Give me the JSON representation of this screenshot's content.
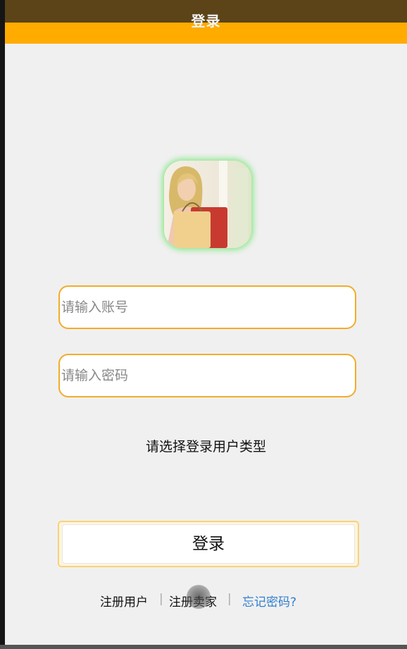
{
  "header": {
    "title": "登录"
  },
  "form": {
    "account_placeholder": "请输入账号",
    "password_placeholder": "请输入密码",
    "user_type_prompt": "请选择登录用户类型",
    "login_label": "登录"
  },
  "footer": {
    "register_user": "注册用户",
    "separator": "|",
    "register_seller": "注册卖家",
    "forgot_password": "忘记密码?"
  },
  "colors": {
    "header_dark": "#5c4418",
    "header_orange": "#ffab00",
    "field_border": "#f3ac2a",
    "link_blue": "#2f7fd0",
    "background": "#f0f0f0"
  },
  "icons": {
    "avatar": "shopping-woman-photo"
  }
}
